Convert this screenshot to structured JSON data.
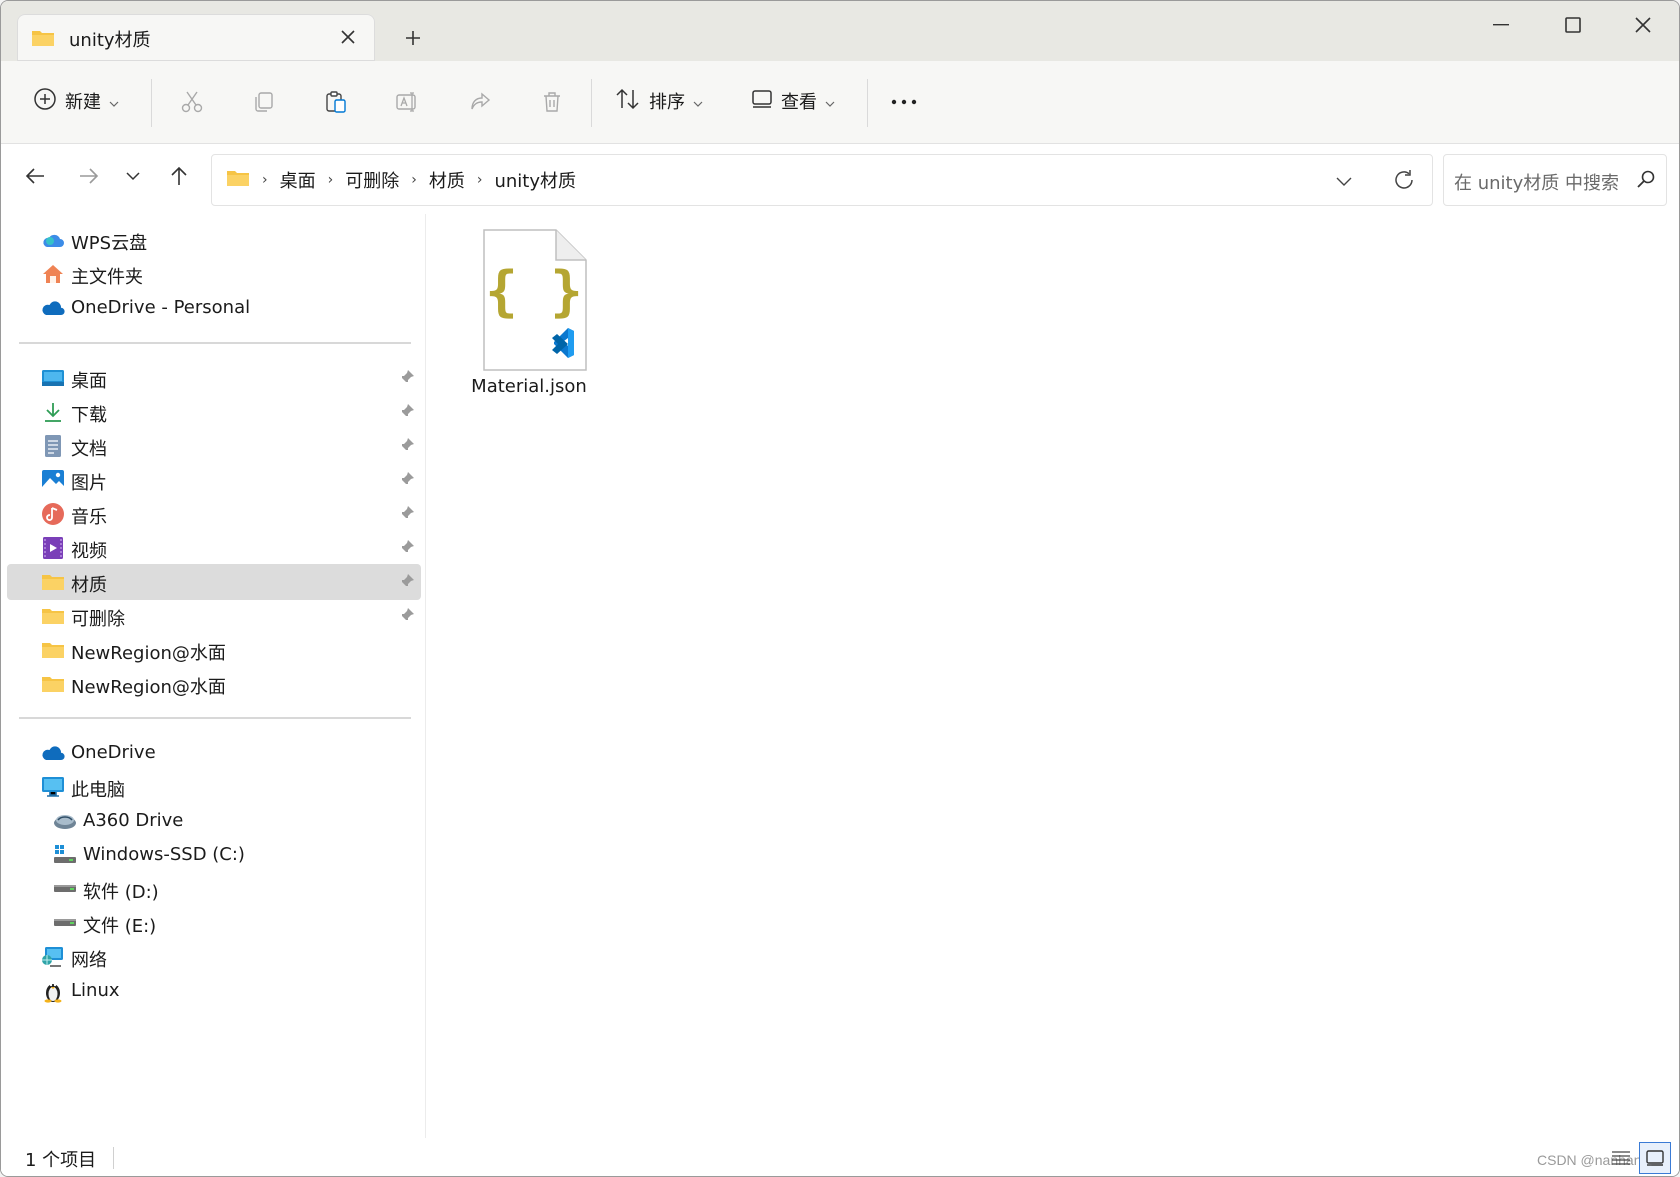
{
  "tab": {
    "title": "unity材质"
  },
  "toolbar": {
    "new_label": "新建",
    "sort_label": "排序",
    "view_label": "查看",
    "more_label": "···"
  },
  "address": {
    "crumbs": [
      "桌面",
      "可删除",
      "材质",
      "unity材质"
    ]
  },
  "search": {
    "placeholder": "在 unity材质 中搜索"
  },
  "sidebar": {
    "top": [
      {
        "label": "WPS云盘",
        "icon": "cloud-icon"
      },
      {
        "label": "主文件夹",
        "icon": "home-icon"
      },
      {
        "label": "OneDrive - Personal",
        "icon": "onedrive-icon"
      }
    ],
    "quick": [
      {
        "label": "桌面",
        "icon": "desktop-icon"
      },
      {
        "label": "下载",
        "icon": "download-icon"
      },
      {
        "label": "文档",
        "icon": "document-icon"
      },
      {
        "label": "图片",
        "icon": "pictures-icon"
      },
      {
        "label": "音乐",
        "icon": "music-icon"
      },
      {
        "label": "视频",
        "icon": "video-icon"
      },
      {
        "label": "材质",
        "icon": "folder-icon",
        "selected": true
      },
      {
        "label": "可删除",
        "icon": "folder-icon"
      },
      {
        "label": "NewRegion@水面",
        "icon": "folder-icon"
      },
      {
        "label": "NewRegion@水面",
        "icon": "folder-icon"
      }
    ],
    "bottom": [
      {
        "label": "OneDrive",
        "icon": "onedrive-icon"
      },
      {
        "label": "此电脑",
        "icon": "computer-icon"
      },
      {
        "label": "A360 Drive",
        "icon": "a360-drive-icon"
      },
      {
        "label": "Windows-SSD (C:)",
        "icon": "windows-drive-icon"
      },
      {
        "label": "软件 (D:)",
        "icon": "drive-icon"
      },
      {
        "label": "文件 (E:)",
        "icon": "drive-icon"
      },
      {
        "label": "网络",
        "icon": "network-icon"
      },
      {
        "label": "Linux",
        "icon": "linux-icon"
      }
    ]
  },
  "files": [
    {
      "name": "Material.json",
      "icon": "json-vscode-file-icon"
    }
  ],
  "status": {
    "item_count": "1 个项目"
  },
  "watermark": "CSDN @nanhan",
  "colors": {
    "folder": "#f6c445",
    "accent": "#0078d4",
    "json_brace": "#b5a632"
  }
}
